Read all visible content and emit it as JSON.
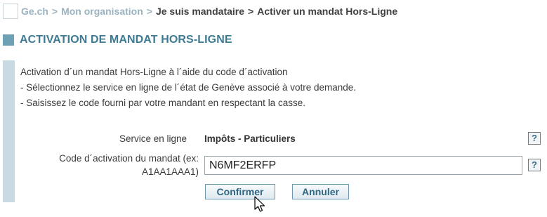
{
  "breadcrumb": {
    "home": "Ge.ch",
    "separator": ">",
    "org": "Mon organisation",
    "mandataire": "Je suis mandataire",
    "current": "Activer un mandat Hors-Ligne"
  },
  "title": "ACTIVATION DE MANDAT HORS-LIGNE",
  "instructions": {
    "intro": "Activation d´un mandat Hors-Ligne à l´aide du code d´activation",
    "step1": " - Sélectionnez le service en ligne de l´état de Genève associé à votre demande.",
    "step2": " - Saisissez le code fourni par votre mandant en respectant la casse."
  },
  "service": {
    "label": "Service en ligne",
    "value": "Impôts - Particuliers",
    "help": "?"
  },
  "code": {
    "label_line1": "Code d´activation du mandat (ex:",
    "label_line2": "A1AA1AAA1)",
    "value": "N6MF2ERFP",
    "help": "?"
  },
  "buttons": {
    "confirm": "Confirmer",
    "cancel": "Annuler"
  },
  "colors": {
    "accent": "#3d7a93",
    "breadcrumb_link": "#9bb3c1",
    "side_bar": "#c9dae3"
  }
}
